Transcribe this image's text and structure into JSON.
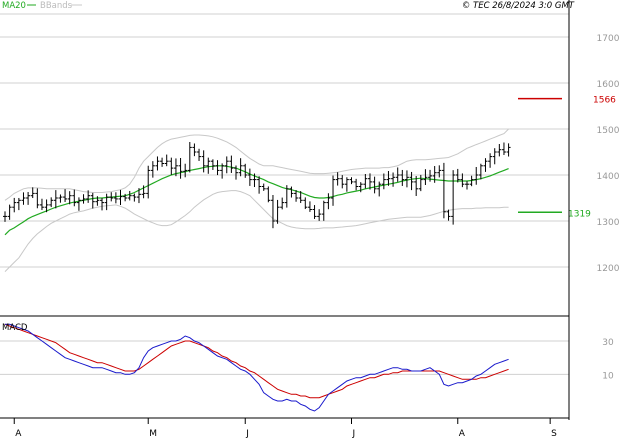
{
  "header": {
    "legend_ma": "MA20",
    "legend_bbands": "BBands",
    "copyright": "© TEC 26/8/2024 3:0 GMT"
  },
  "colors": {
    "candle": "#000000",
    "ma20": "#22aa22",
    "bbands": "#c8c8c8",
    "resistance": "#cc0000",
    "support": "#22aa22",
    "macd": "#1a1acc",
    "signal": "#cc0000",
    "grid": "#d0d0d0",
    "axis": "#000000",
    "label": "#999999"
  },
  "chart_data": [
    {
      "type": "ohlc",
      "title": "",
      "x_months": [
        {
          "label": "A",
          "index": 2
        },
        {
          "label": "M",
          "index": 31
        },
        {
          "label": "J",
          "index": 52
        },
        {
          "label": "J",
          "index": 75
        },
        {
          "label": "A",
          "index": 98
        },
        {
          "label": "S",
          "index": 118
        }
      ],
      "ylim": [
        1100,
        1750
      ],
      "yticks": [
        1200,
        1300,
        1400,
        1500,
        1600,
        1700
      ],
      "ytick_labels": [
        "1200",
        "1300",
        "1400",
        "1500",
        "1600",
        "1700"
      ],
      "grid": true,
      "close": [
        1310,
        1330,
        1340,
        1345,
        1350,
        1355,
        1360,
        1335,
        1330,
        1335,
        1345,
        1350,
        1352,
        1348,
        1355,
        1340,
        1345,
        1348,
        1355,
        1342,
        1345,
        1340,
        1352,
        1350,
        1348,
        1353,
        1350,
        1355,
        1352,
        1358,
        1360,
        1410,
        1420,
        1430,
        1425,
        1430,
        1415,
        1420,
        1408,
        1410,
        1460,
        1450,
        1440,
        1420,
        1430,
        1420,
        1410,
        1420,
        1430,
        1415,
        1405,
        1420,
        1400,
        1390,
        1390,
        1375,
        1370,
        1345,
        1300,
        1330,
        1340,
        1370,
        1360,
        1350,
        1345,
        1330,
        1325,
        1310,
        1315,
        1340,
        1350,
        1390,
        1392,
        1380,
        1390,
        1385,
        1375,
        1380,
        1392,
        1385,
        1370,
        1380,
        1390,
        1392,
        1395,
        1400,
        1390,
        1395,
        1385,
        1370,
        1390,
        1395,
        1398,
        1405,
        1410,
        1320,
        1310,
        1400,
        1390,
        1380,
        1380,
        1390,
        1400,
        1420,
        1430,
        1440,
        1450,
        1455,
        1450,
        1460
      ],
      "series": [
        {
          "name": "MA20",
          "values": [
            1270,
            1280,
            1285,
            1292,
            1298,
            1305,
            1310,
            1314,
            1318,
            1322,
            1326,
            1330,
            1333,
            1336,
            1339,
            1341,
            1343,
            1345,
            1347,
            1349,
            1350,
            1350,
            1351,
            1352,
            1353,
            1354,
            1355,
            1358,
            1362,
            1367,
            1372,
            1377,
            1382,
            1387,
            1392,
            1396,
            1400,
            1403,
            1405,
            1407,
            1410,
            1412,
            1414,
            1416,
            1418,
            1419,
            1420,
            1420,
            1419,
            1417,
            1415,
            1411,
            1407,
            1402,
            1398,
            1394,
            1390,
            1385,
            1381,
            1377,
            1373,
            1370,
            1368,
            1365,
            1362,
            1358,
            1354,
            1351,
            1350,
            1350,
            1351,
            1353,
            1356,
            1358,
            1361,
            1363,
            1365,
            1367,
            1370,
            1372,
            1374,
            1376,
            1378,
            1380,
            1382,
            1384,
            1387,
            1389,
            1391,
            1392,
            1393,
            1392,
            1391,
            1390,
            1389,
            1388,
            1387,
            1387,
            1387,
            1387,
            1387,
            1388,
            1390,
            1392,
            1395,
            1398,
            1402,
            1406,
            1410,
            1414
          ]
        },
        {
          "name": "BBands upper",
          "values": [
            1345,
            1352,
            1360,
            1365,
            1370,
            1372,
            1372,
            1372,
            1371,
            1370,
            1370,
            1370,
            1370,
            1370,
            1370,
            1368,
            1366,
            1364,
            1363,
            1362,
            1362,
            1362,
            1363,
            1364,
            1366,
            1368,
            1372,
            1380,
            1395,
            1415,
            1430,
            1440,
            1450,
            1460,
            1468,
            1474,
            1478,
            1480,
            1482,
            1484,
            1486,
            1487,
            1487,
            1486,
            1485,
            1483,
            1480,
            1476,
            1472,
            1466,
            1460,
            1452,
            1444,
            1436,
            1430,
            1424,
            1420,
            1420,
            1420,
            1418,
            1416,
            1414,
            1412,
            1410,
            1408,
            1406,
            1404,
            1403,
            1403,
            1403,
            1404,
            1405,
            1406,
            1408,
            1410,
            1412,
            1413,
            1414,
            1415,
            1415,
            1415,
            1415,
            1416,
            1416,
            1418,
            1420,
            1425,
            1430,
            1432,
            1433,
            1433,
            1433,
            1434,
            1435,
            1436,
            1437,
            1438,
            1442,
            1446,
            1452,
            1458,
            1462,
            1466,
            1470,
            1474,
            1478,
            1482,
            1486,
            1490,
            1500
          ]
        },
        {
          "name": "BBands lower",
          "values": [
            1190,
            1200,
            1210,
            1220,
            1235,
            1250,
            1262,
            1272,
            1280,
            1288,
            1295,
            1300,
            1305,
            1310,
            1315,
            1318,
            1320,
            1322,
            1325,
            1328,
            1330,
            1332,
            1333,
            1334,
            1335,
            1332,
            1328,
            1322,
            1315,
            1310,
            1305,
            1300,
            1296,
            1292,
            1290,
            1290,
            1292,
            1298,
            1305,
            1312,
            1320,
            1330,
            1338,
            1346,
            1352,
            1358,
            1362,
            1364,
            1365,
            1366,
            1366,
            1364,
            1360,
            1355,
            1345,
            1335,
            1325,
            1315,
            1305,
            1300,
            1295,
            1290,
            1287,
            1285,
            1284,
            1283,
            1283,
            1283,
            1284,
            1285,
            1285,
            1285,
            1286,
            1287,
            1288,
            1289,
            1290,
            1292,
            1294,
            1296,
            1298,
            1300,
            1302,
            1304,
            1305,
            1306,
            1307,
            1308,
            1308,
            1308,
            1308,
            1310,
            1312,
            1315,
            1318,
            1321,
            1323,
            1325,
            1326,
            1327,
            1327,
            1327,
            1328,
            1328,
            1329,
            1329,
            1329,
            1329,
            1330,
            1330
          ]
        }
      ],
      "levels": [
        {
          "name": "resistance",
          "value": 1566,
          "label": "1566"
        },
        {
          "name": "support",
          "value": 1319,
          "label": "1319"
        }
      ]
    },
    {
      "type": "line",
      "title": "MACD",
      "ylim": [
        -15,
        45
      ],
      "yticks": [
        30,
        10
      ],
      "ytick_labels": [
        "30",
        "10"
      ],
      "grid": true,
      "series": [
        {
          "name": "MACD",
          "values": [
            40,
            40,
            39,
            38,
            37,
            36,
            34,
            32,
            30,
            28,
            26,
            24,
            22,
            20,
            19,
            18,
            17,
            16,
            15,
            14,
            14,
            14,
            13,
            12,
            11,
            11,
            10,
            10,
            11,
            14,
            20,
            24,
            26,
            27,
            28,
            29,
            30,
            30,
            31,
            33,
            32,
            30,
            29,
            27,
            25,
            23,
            21,
            20,
            19,
            17,
            15,
            13,
            12,
            10,
            7,
            4,
            -1,
            -3,
            -5,
            -6,
            -6,
            -5,
            -6,
            -6,
            -8,
            -9,
            -11,
            -12,
            -10,
            -6,
            -2,
            0,
            2,
            4,
            6,
            7,
            8,
            8,
            9,
            10,
            10,
            11,
            12,
            13,
            14,
            14,
            13,
            13,
            12,
            12,
            12,
            13,
            14,
            12,
            10,
            4,
            3,
            4,
            5,
            5,
            6,
            7,
            9,
            10,
            12,
            14,
            16,
            17,
            18,
            19
          ]
        },
        {
          "name": "Signal",
          "values": [
            40,
            39,
            38,
            37,
            36,
            35,
            34,
            33,
            32,
            31,
            30,
            29,
            27,
            25,
            23,
            22,
            21,
            20,
            19,
            18,
            17,
            17,
            16,
            15,
            14,
            13,
            12,
            12,
            12,
            13,
            15,
            17,
            19,
            21,
            23,
            25,
            27,
            28,
            29,
            30,
            30,
            29,
            28,
            27,
            26,
            24,
            23,
            21,
            20,
            18,
            17,
            15,
            14,
            12,
            11,
            9,
            7,
            5,
            3,
            1,
            0,
            -1,
            -2,
            -2,
            -3,
            -3,
            -4,
            -4,
            -4,
            -3,
            -2,
            -1,
            0,
            1,
            3,
            4,
            5,
            6,
            7,
            8,
            8,
            9,
            10,
            10,
            11,
            11,
            12,
            12,
            12,
            12,
            12,
            12,
            12,
            12,
            12,
            11,
            10,
            9,
            8,
            7,
            7,
            7,
            7,
            8,
            8,
            9,
            10,
            11,
            12,
            13
          ]
        }
      ]
    }
  ]
}
